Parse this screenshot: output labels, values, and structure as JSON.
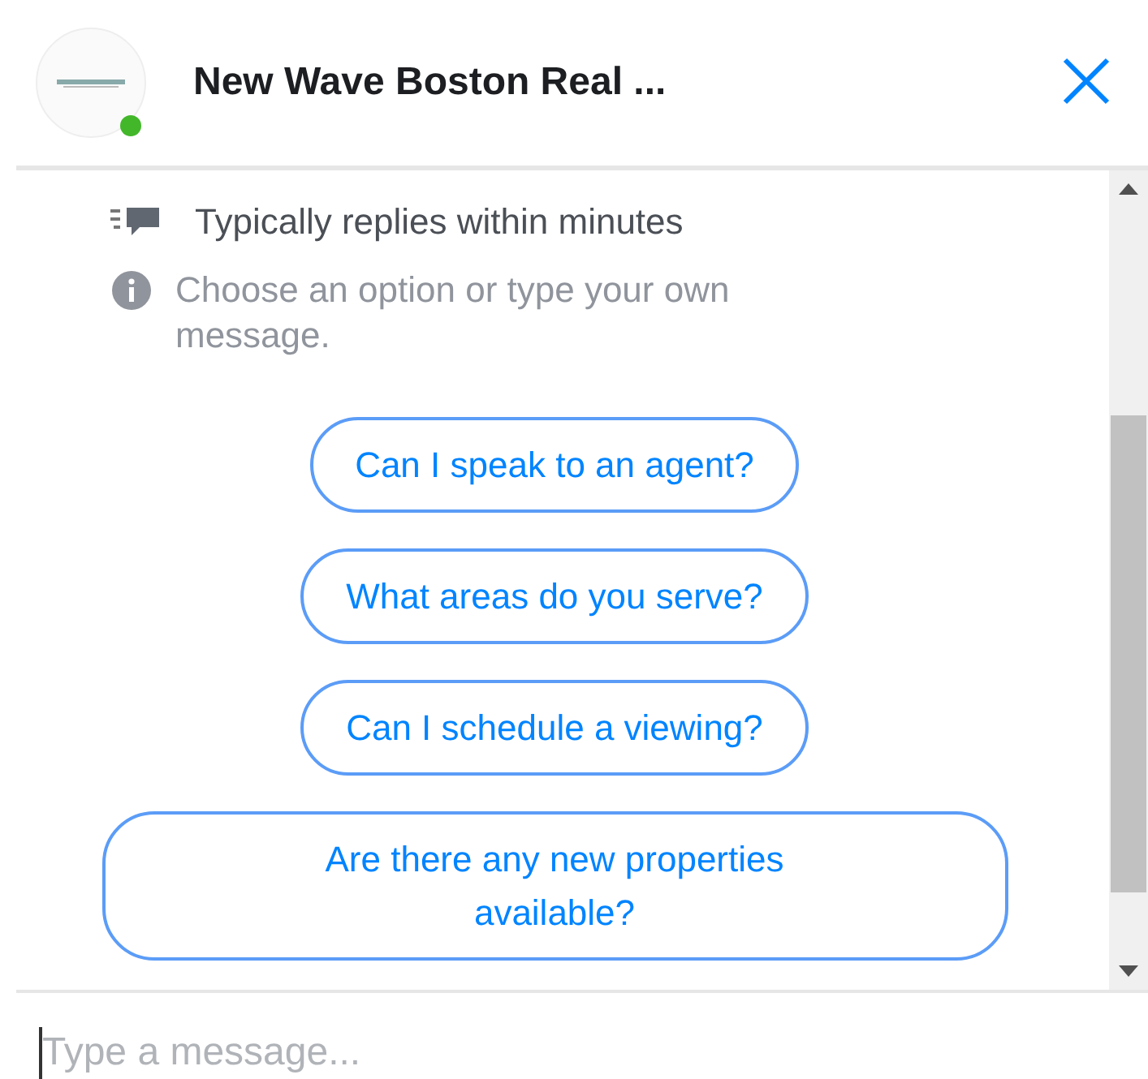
{
  "header": {
    "title": "New Wave Boston Real ...",
    "online": true
  },
  "notices": [
    {
      "kind": "reply-time",
      "text": "Typically replies within minutes"
    },
    {
      "kind": "info",
      "text": "Choose an option or type your own message."
    }
  ],
  "quick_replies": [
    {
      "label": "Can I speak to an agent?"
    },
    {
      "label": "What areas do you serve?"
    },
    {
      "label": "Can I schedule a viewing?"
    },
    {
      "label": "Are there any new properties available?"
    }
  ],
  "composer": {
    "placeholder": "Type a message..."
  }
}
